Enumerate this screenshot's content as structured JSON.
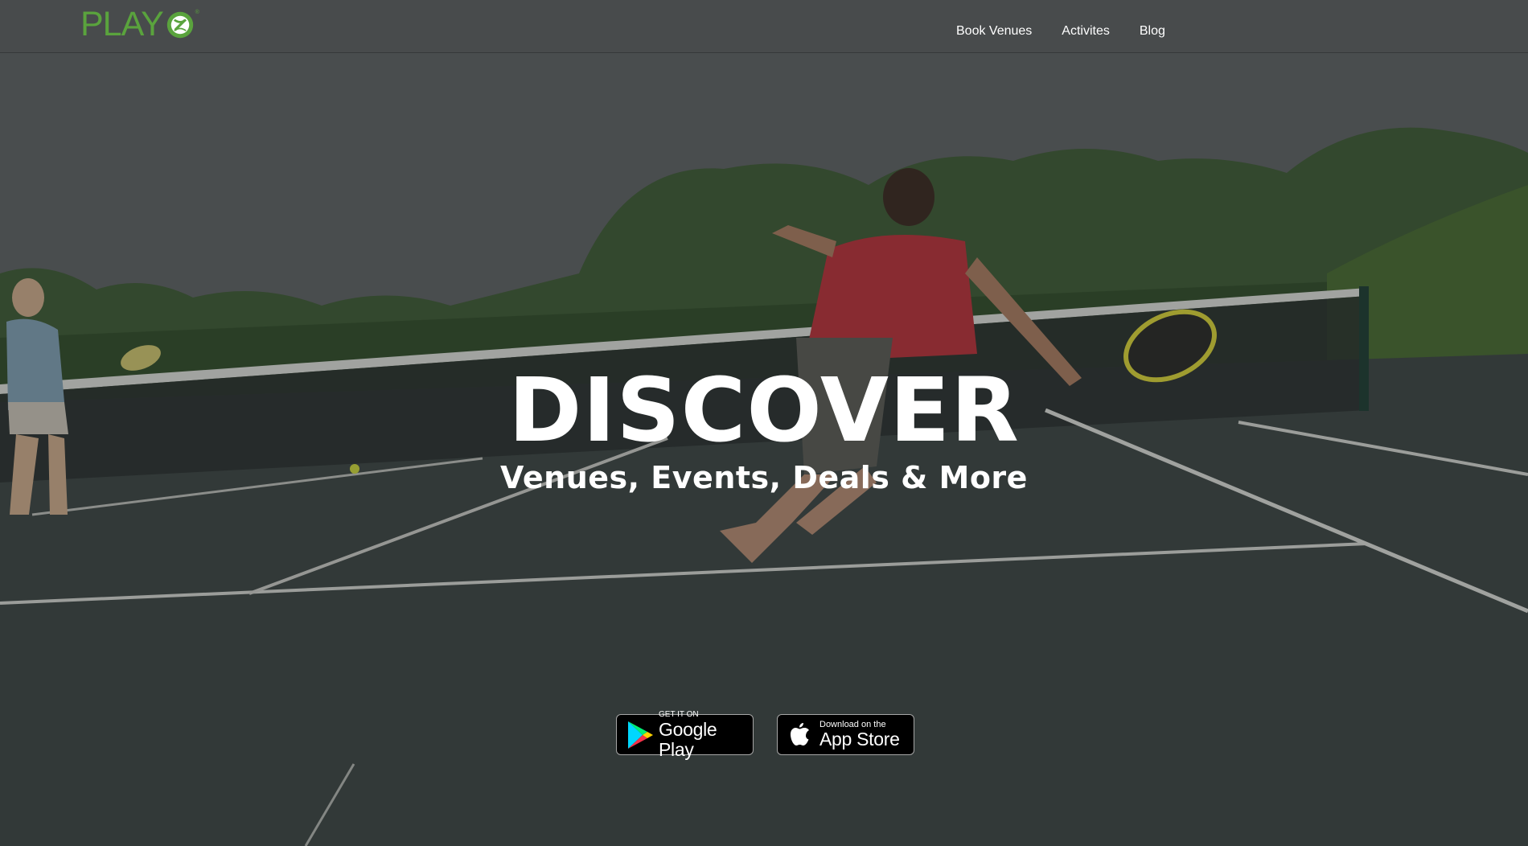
{
  "brand": {
    "logo_text": "PLAY",
    "logo_icon": "tennis-ball-icon",
    "accent_color": "#5aa33d"
  },
  "nav": {
    "items": [
      {
        "label": "Book Venues"
      },
      {
        "label": "Activites"
      },
      {
        "label": "Blog"
      }
    ]
  },
  "hero": {
    "headline": "DISCOVER",
    "subheadline": "Venues, Events, Deals & More"
  },
  "badges": {
    "google_play": {
      "small": "GET IT ON",
      "big": "Google Play",
      "icon": "google-play-icon"
    },
    "app_store": {
      "small": "Download on the",
      "big": "App Store",
      "icon": "apple-icon"
    }
  }
}
